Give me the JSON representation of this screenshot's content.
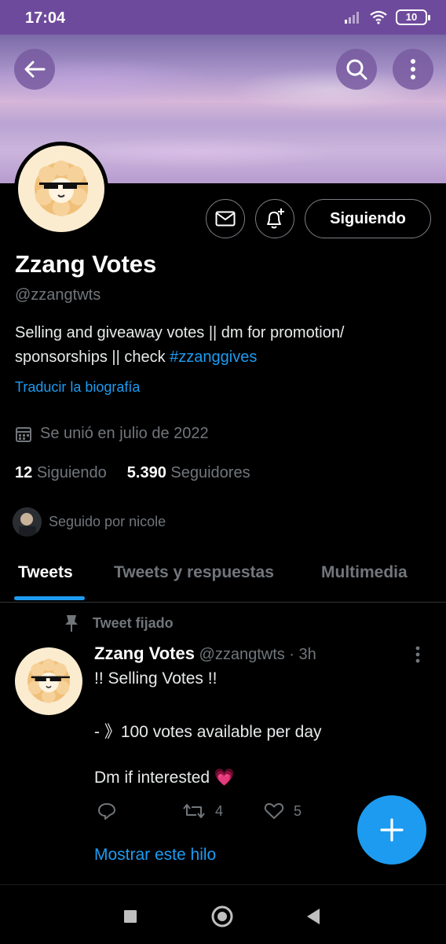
{
  "status_bar": {
    "time": "17:04",
    "battery": "10"
  },
  "profile": {
    "name": "Zzang Votes",
    "handle": "@zzangtwts",
    "bio_text": "Selling and giveaway votes || dm for promotion/ sponsorships || check ",
    "bio_hashtag": "#zzanggives",
    "translate_label": "Traducir la biografía",
    "joined": "Se unió en julio de 2022",
    "following_count": "12",
    "following_label": "Siguiendo",
    "followers_count": "5.390",
    "followers_label": "Seguidores",
    "followed_by": "Seguido por nicole",
    "follow_button_label": "Siguiendo"
  },
  "tabs": [
    {
      "label": "Tweets",
      "active": true
    },
    {
      "label": "Tweets y respuestas",
      "active": false
    },
    {
      "label": "Multimedia",
      "active": false
    }
  ],
  "tweet": {
    "pinned_label": "Tweet fijado",
    "author_name": "Zzang Votes",
    "author_meta": "@zzangtwts · 3h",
    "line1": "!! Selling Votes !!",
    "line2": "- 》100 votes available per day",
    "line3": "Dm if interested",
    "line3_emoji": "💗",
    "retweets": "4",
    "likes": "5",
    "show_thread": "Mostrar este hilo"
  },
  "colors": {
    "accent": "#1d9bf0",
    "status_bar": "#6e4a9c",
    "background": "#000000"
  }
}
